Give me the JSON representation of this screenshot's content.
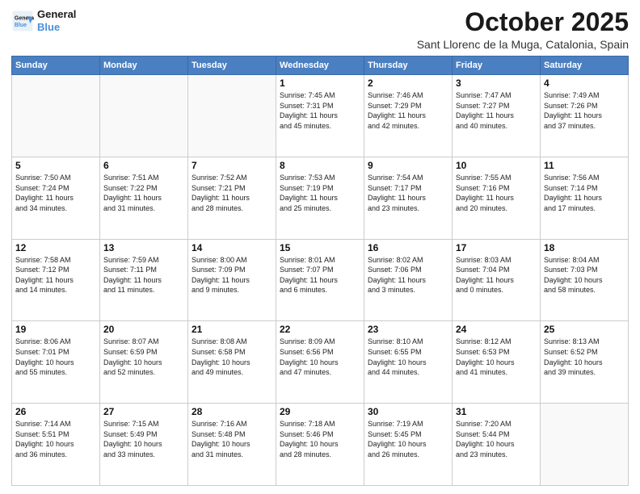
{
  "header": {
    "logo_line1": "General",
    "logo_line2": "Blue",
    "month": "October 2025",
    "location": "Sant Llorenc de la Muga, Catalonia, Spain"
  },
  "weekdays": [
    "Sunday",
    "Monday",
    "Tuesday",
    "Wednesday",
    "Thursday",
    "Friday",
    "Saturday"
  ],
  "weeks": [
    [
      {
        "day": "",
        "info": ""
      },
      {
        "day": "",
        "info": ""
      },
      {
        "day": "",
        "info": ""
      },
      {
        "day": "1",
        "info": "Sunrise: 7:45 AM\nSunset: 7:31 PM\nDaylight: 11 hours\nand 45 minutes."
      },
      {
        "day": "2",
        "info": "Sunrise: 7:46 AM\nSunset: 7:29 PM\nDaylight: 11 hours\nand 42 minutes."
      },
      {
        "day": "3",
        "info": "Sunrise: 7:47 AM\nSunset: 7:27 PM\nDaylight: 11 hours\nand 40 minutes."
      },
      {
        "day": "4",
        "info": "Sunrise: 7:49 AM\nSunset: 7:26 PM\nDaylight: 11 hours\nand 37 minutes."
      }
    ],
    [
      {
        "day": "5",
        "info": "Sunrise: 7:50 AM\nSunset: 7:24 PM\nDaylight: 11 hours\nand 34 minutes."
      },
      {
        "day": "6",
        "info": "Sunrise: 7:51 AM\nSunset: 7:22 PM\nDaylight: 11 hours\nand 31 minutes."
      },
      {
        "day": "7",
        "info": "Sunrise: 7:52 AM\nSunset: 7:21 PM\nDaylight: 11 hours\nand 28 minutes."
      },
      {
        "day": "8",
        "info": "Sunrise: 7:53 AM\nSunset: 7:19 PM\nDaylight: 11 hours\nand 25 minutes."
      },
      {
        "day": "9",
        "info": "Sunrise: 7:54 AM\nSunset: 7:17 PM\nDaylight: 11 hours\nand 23 minutes."
      },
      {
        "day": "10",
        "info": "Sunrise: 7:55 AM\nSunset: 7:16 PM\nDaylight: 11 hours\nand 20 minutes."
      },
      {
        "day": "11",
        "info": "Sunrise: 7:56 AM\nSunset: 7:14 PM\nDaylight: 11 hours\nand 17 minutes."
      }
    ],
    [
      {
        "day": "12",
        "info": "Sunrise: 7:58 AM\nSunset: 7:12 PM\nDaylight: 11 hours\nand 14 minutes."
      },
      {
        "day": "13",
        "info": "Sunrise: 7:59 AM\nSunset: 7:11 PM\nDaylight: 11 hours\nand 11 minutes."
      },
      {
        "day": "14",
        "info": "Sunrise: 8:00 AM\nSunset: 7:09 PM\nDaylight: 11 hours\nand 9 minutes."
      },
      {
        "day": "15",
        "info": "Sunrise: 8:01 AM\nSunset: 7:07 PM\nDaylight: 11 hours\nand 6 minutes."
      },
      {
        "day": "16",
        "info": "Sunrise: 8:02 AM\nSunset: 7:06 PM\nDaylight: 11 hours\nand 3 minutes."
      },
      {
        "day": "17",
        "info": "Sunrise: 8:03 AM\nSunset: 7:04 PM\nDaylight: 11 hours\nand 0 minutes."
      },
      {
        "day": "18",
        "info": "Sunrise: 8:04 AM\nSunset: 7:03 PM\nDaylight: 10 hours\nand 58 minutes."
      }
    ],
    [
      {
        "day": "19",
        "info": "Sunrise: 8:06 AM\nSunset: 7:01 PM\nDaylight: 10 hours\nand 55 minutes."
      },
      {
        "day": "20",
        "info": "Sunrise: 8:07 AM\nSunset: 6:59 PM\nDaylight: 10 hours\nand 52 minutes."
      },
      {
        "day": "21",
        "info": "Sunrise: 8:08 AM\nSunset: 6:58 PM\nDaylight: 10 hours\nand 49 minutes."
      },
      {
        "day": "22",
        "info": "Sunrise: 8:09 AM\nSunset: 6:56 PM\nDaylight: 10 hours\nand 47 minutes."
      },
      {
        "day": "23",
        "info": "Sunrise: 8:10 AM\nSunset: 6:55 PM\nDaylight: 10 hours\nand 44 minutes."
      },
      {
        "day": "24",
        "info": "Sunrise: 8:12 AM\nSunset: 6:53 PM\nDaylight: 10 hours\nand 41 minutes."
      },
      {
        "day": "25",
        "info": "Sunrise: 8:13 AM\nSunset: 6:52 PM\nDaylight: 10 hours\nand 39 minutes."
      }
    ],
    [
      {
        "day": "26",
        "info": "Sunrise: 7:14 AM\nSunset: 5:51 PM\nDaylight: 10 hours\nand 36 minutes."
      },
      {
        "day": "27",
        "info": "Sunrise: 7:15 AM\nSunset: 5:49 PM\nDaylight: 10 hours\nand 33 minutes."
      },
      {
        "day": "28",
        "info": "Sunrise: 7:16 AM\nSunset: 5:48 PM\nDaylight: 10 hours\nand 31 minutes."
      },
      {
        "day": "29",
        "info": "Sunrise: 7:18 AM\nSunset: 5:46 PM\nDaylight: 10 hours\nand 28 minutes."
      },
      {
        "day": "30",
        "info": "Sunrise: 7:19 AM\nSunset: 5:45 PM\nDaylight: 10 hours\nand 26 minutes."
      },
      {
        "day": "31",
        "info": "Sunrise: 7:20 AM\nSunset: 5:44 PM\nDaylight: 10 hours\nand 23 minutes."
      },
      {
        "day": "",
        "info": ""
      }
    ]
  ]
}
